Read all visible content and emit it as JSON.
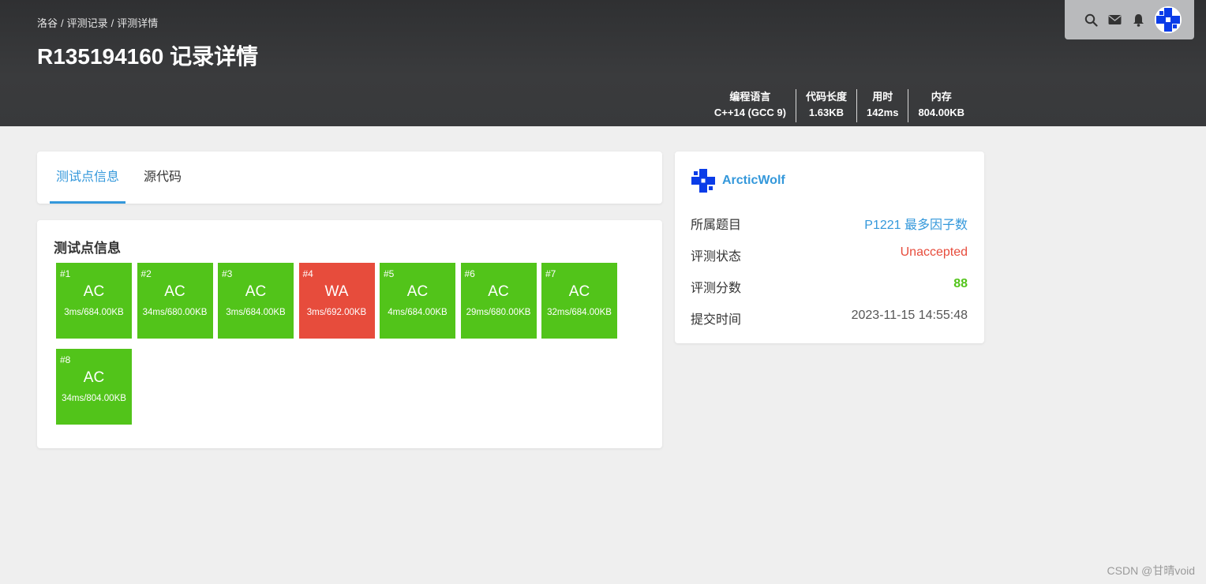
{
  "header": {
    "breadcrumb": [
      "洛谷",
      "评测记录",
      "评测详情"
    ],
    "breadcrumb_sep": "/",
    "title": "R135194160 记录详情",
    "stats": [
      {
        "key": "编程语言",
        "value": "C++14 (GCC 9)"
      },
      {
        "key": "代码长度",
        "value": "1.63KB"
      },
      {
        "key": "用时",
        "value": "142ms"
      },
      {
        "key": "内存",
        "value": "804.00KB"
      }
    ]
  },
  "tabs": [
    {
      "label": "测试点信息",
      "active": true
    },
    {
      "label": "源代码",
      "active": false
    }
  ],
  "cases_section": {
    "title": "测试点信息",
    "cases": [
      {
        "num": "#1",
        "status": "AC",
        "detail": "3ms/684.00KB",
        "color": "#52c41a"
      },
      {
        "num": "#2",
        "status": "AC",
        "detail": "34ms/680.00KB",
        "color": "#52c41a"
      },
      {
        "num": "#3",
        "status": "AC",
        "detail": "3ms/684.00KB",
        "color": "#52c41a"
      },
      {
        "num": "#4",
        "status": "WA",
        "detail": "3ms/692.00KB",
        "color": "#e74c3c"
      },
      {
        "num": "#5",
        "status": "AC",
        "detail": "4ms/684.00KB",
        "color": "#52c41a"
      },
      {
        "num": "#6",
        "status": "AC",
        "detail": "29ms/680.00KB",
        "color": "#52c41a"
      },
      {
        "num": "#7",
        "status": "AC",
        "detail": "32ms/684.00KB",
        "color": "#52c41a"
      },
      {
        "num": "#8",
        "status": "AC",
        "detail": "34ms/804.00KB",
        "color": "#52c41a"
      }
    ]
  },
  "info": {
    "username": "ArcticWolf",
    "rows": [
      {
        "label": "所属题目",
        "value": "P1221 最多因子数",
        "style": "link"
      },
      {
        "label": "评测状态",
        "value": "Unaccepted",
        "style": "red"
      },
      {
        "label": "评测分数",
        "value": "88",
        "style": "green"
      },
      {
        "label": "提交时间",
        "value": "2023-11-15 14:55:48",
        "style": "plain"
      }
    ]
  },
  "nav_icons": [
    "search-icon",
    "mail-icon",
    "bell-icon"
  ],
  "watermark": "CSDN @甘晴void",
  "colors": {
    "accent": "#3498db",
    "ac": "#52c41a",
    "wa": "#e74c3c",
    "header": "#343537"
  }
}
